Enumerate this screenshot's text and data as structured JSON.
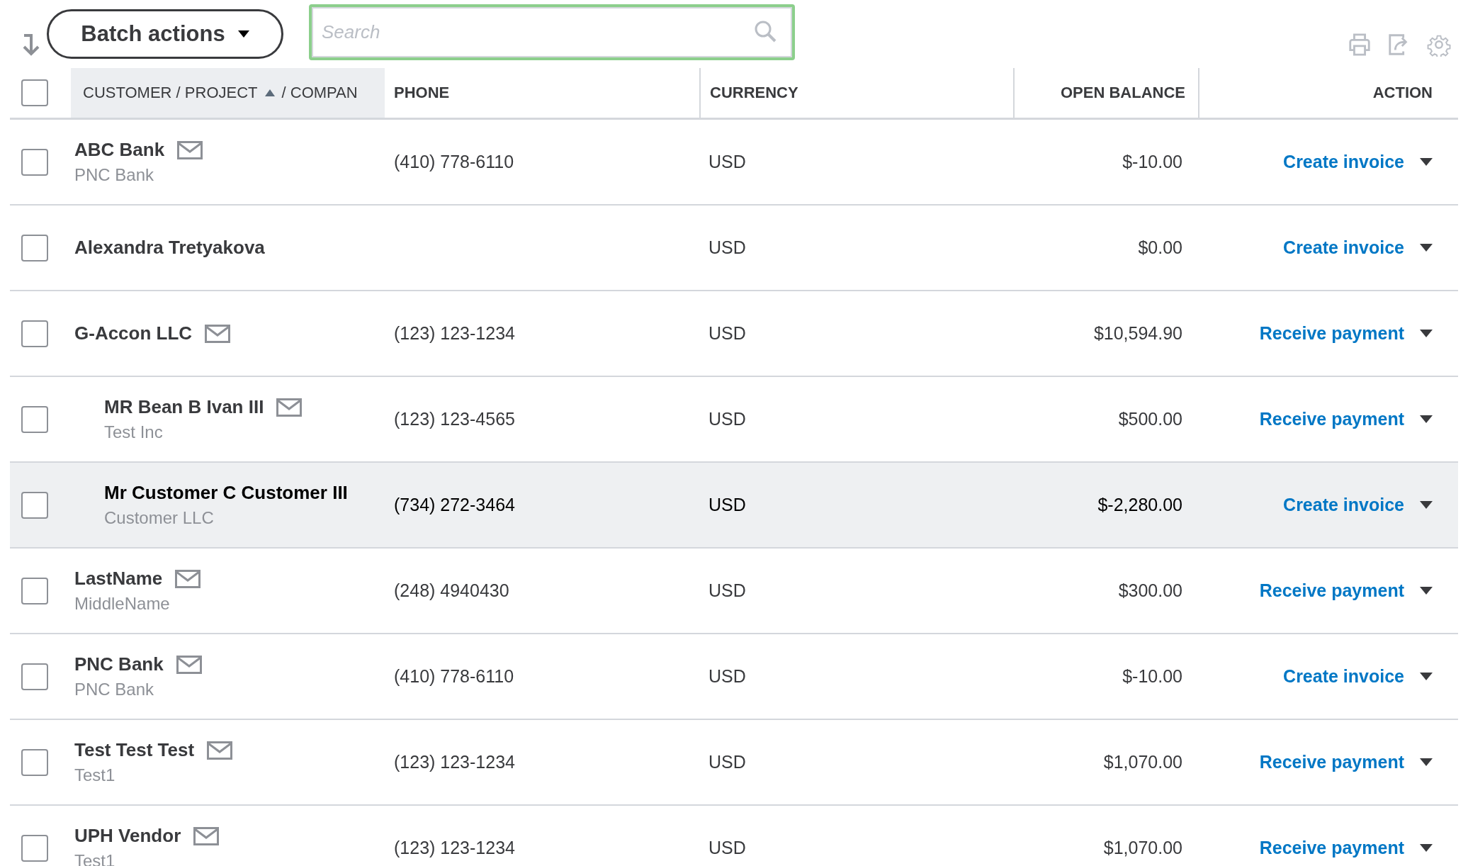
{
  "toolbar": {
    "batch_button": "Batch actions",
    "search": {
      "placeholder": "Search"
    }
  },
  "table": {
    "select_all_checked": false,
    "columns": [
      {
        "kind": "customer",
        "label": "CUSTOMER / PROJECT",
        "sort_ascending": true,
        "label_2": "/ COMPAN"
      },
      {
        "kind": "phone",
        "label": "PHONE"
      },
      {
        "kind": "currency",
        "label": "CURRENCY"
      },
      {
        "kind": "balance",
        "label": "OPEN BALANCE"
      },
      {
        "kind": "action",
        "label": "ACTION"
      }
    ],
    "rows": [
      {
        "name": "ABC Bank",
        "company": "PNC Bank",
        "has_email": true,
        "phone": "(410) 778-6110",
        "currency": "USD",
        "balance": "$-10.00",
        "action": "Create invoice",
        "checked": false,
        "hovered": false
      },
      {
        "name": "Alexandra Tretyakova",
        "has_email": false,
        "currency": "USD",
        "balance": "$0.00",
        "action": "Create invoice",
        "checked": false,
        "hovered": false
      },
      {
        "name": "G-Accon LLC",
        "has_email": true,
        "phone": "(123) 123-1234",
        "currency": "USD",
        "balance": "$10,594.90",
        "action": "Receive payment",
        "checked": false,
        "hovered": false,
        "children": [
          {
            "name": "MR Bean B Ivan III",
            "company": "Test Inc",
            "has_email": true,
            "phone": "(123) 123-4565",
            "currency": "USD",
            "balance": "$500.00",
            "action": "Receive payment",
            "checked": false,
            "hovered": false
          },
          {
            "name": "Mr Customer C Customer III",
            "company": "Customer LLC",
            "has_email": false,
            "phone": "(734) 272-3464",
            "currency": "USD",
            "balance": "$-2,280.00",
            "action": "Create invoice",
            "checked": false,
            "hovered": true
          }
        ]
      },
      {
        "name": "LastName",
        "company": "MiddleName",
        "has_email": true,
        "phone": "(248) 4940430",
        "currency": "USD",
        "balance": "$300.00",
        "action": "Receive payment",
        "checked": false,
        "hovered": false
      },
      {
        "name": "PNC Bank",
        "company": "PNC Bank",
        "has_email": true,
        "phone": "(410) 778-6110",
        "currency": "USD",
        "balance": "$-10.00",
        "action": "Create invoice",
        "checked": false,
        "hovered": false
      },
      {
        "name": "Test Test Test",
        "company": "Test1",
        "has_email": true,
        "phone": "(123) 123-1234",
        "currency": "USD",
        "balance": "$1,070.00",
        "action": "Receive payment",
        "checked": false,
        "hovered": false
      },
      {
        "name": "UPH Vendor",
        "company": "Test1",
        "has_email": true,
        "phone": "(123) 123-1234",
        "currency": "USD",
        "balance": "$1,070.00",
        "action": "Receive payment",
        "checked": false,
        "hovered": false
      }
    ]
  }
}
